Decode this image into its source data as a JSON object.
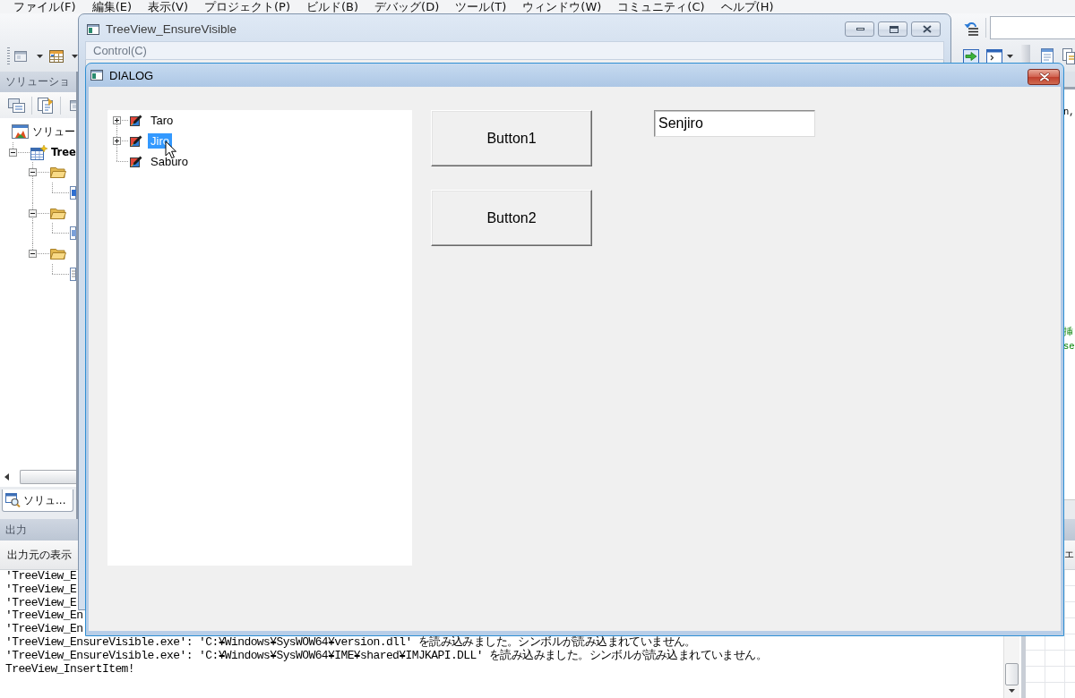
{
  "ide": {
    "menu": [
      "ファイル(F)",
      "編集(E)",
      "表示(V)",
      "プロジェクト(P)",
      "ビルド(B)",
      "デバッグ(D)",
      "ツール(T)",
      "ウィンドウ(W)",
      "コミュニティ(C)",
      "ヘルプ(H)"
    ],
    "solution_explorer": {
      "title": "ソリューショ",
      "tree": [
        {
          "kind": "solution",
          "label": "ソリュー",
          "children": [
            {
              "kind": "project",
              "label": "Tree",
              "expanded": true,
              "children": [
                {
                  "kind": "folder",
                  "expanded": true,
                  "children": [
                    {
                      "kind": "source-file"
                    }
                  ]
                },
                {
                  "kind": "folder",
                  "expanded": true,
                  "children": [
                    {
                      "kind": "header-file"
                    }
                  ]
                },
                {
                  "kind": "folder",
                  "expanded": true,
                  "children": [
                    {
                      "kind": "resource-file"
                    }
                  ]
                }
              ]
            }
          ]
        }
      ],
      "tab": "ソリュ..."
    },
    "editor_fragments": [
      {
        "kind": "code",
        "text": "n,"
      },
      {
        "kind": "comment",
        "text": "挿"
      },
      {
        "kind": "comment",
        "text": "se"
      }
    ],
    "output": {
      "title": "出力",
      "source_label": "出力元の表示",
      "lines": [
        "'TreeView_E",
        "'TreeView_E",
        "'TreeView_E",
        "'TreeView_En",
        "'TreeView_En",
        "'TreeView_EnsureVisible.exe': 'C:¥Windows¥SysWOW64¥version.dll' を読み込みました。シンボルが読み込まれていません。",
        "'TreeView_EnsureVisible.exe': 'C:¥Windows¥SysWOW64¥IME¥shared¥IMJKAPI.DLL' を読み込みました。シンボルが読み込まれていません。",
        "TreeView_InsertItem!"
      ]
    },
    "side_panel": {
      "toolbar_text": "エ"
    }
  },
  "main_window": {
    "title": "TreeView_EnsureVisible",
    "menu": [
      "Control(C)"
    ]
  },
  "dialog": {
    "title": "DIALOG",
    "tree": [
      {
        "label": "Taro",
        "kind": "collapsed",
        "selected": false
      },
      {
        "label": "Jiro",
        "kind": "collapsed",
        "selected": true
      },
      {
        "label": "Saburo",
        "kind": "leaf",
        "selected": false
      }
    ],
    "buttons": [
      "Button1",
      "Button2"
    ],
    "edit": {
      "value": "Senjiro"
    }
  }
}
